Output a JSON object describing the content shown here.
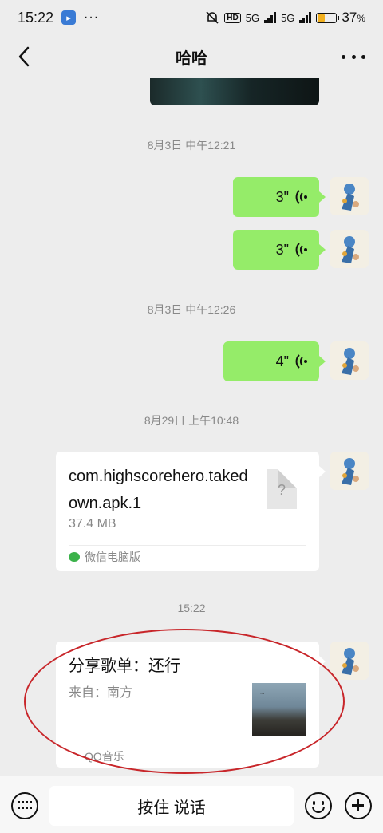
{
  "status_bar": {
    "time": "15:22",
    "more": "···",
    "hd": "HD",
    "net1": "5G",
    "net2": "5G",
    "battery_pct": "37",
    "battery_pct_sign": "%",
    "battery_level": 0.37,
    "battery_color": "#f2b01e",
    "icons": [
      "app-badge-icon",
      "mute-bell-icon",
      "signal-icon",
      "battery-icon"
    ]
  },
  "header": {
    "title": "哈哈",
    "back_icon": "chevron-left-icon",
    "menu_icon": "more-dots-icon"
  },
  "messages": {
    "ts1": "8月3日 中午12:21",
    "voice1_duration": "3\"",
    "voice2_duration": "3\"",
    "ts2": "8月3日 中午12:26",
    "voice3_duration": "4\"",
    "ts3": "8月29日 上午10:48",
    "file": {
      "name": "com.highscorehero.takedown.apk.1",
      "size": "37.4 MB",
      "icon_glyph": "?",
      "source": "微信电脑版"
    },
    "ts4": "15:22",
    "music": {
      "title": "分享歌单：还行",
      "from": "来自：南方",
      "source": "QQ音乐"
    },
    "bubble_color": "#95ec69"
  },
  "input_bar": {
    "talk_label": "按住 说话"
  }
}
